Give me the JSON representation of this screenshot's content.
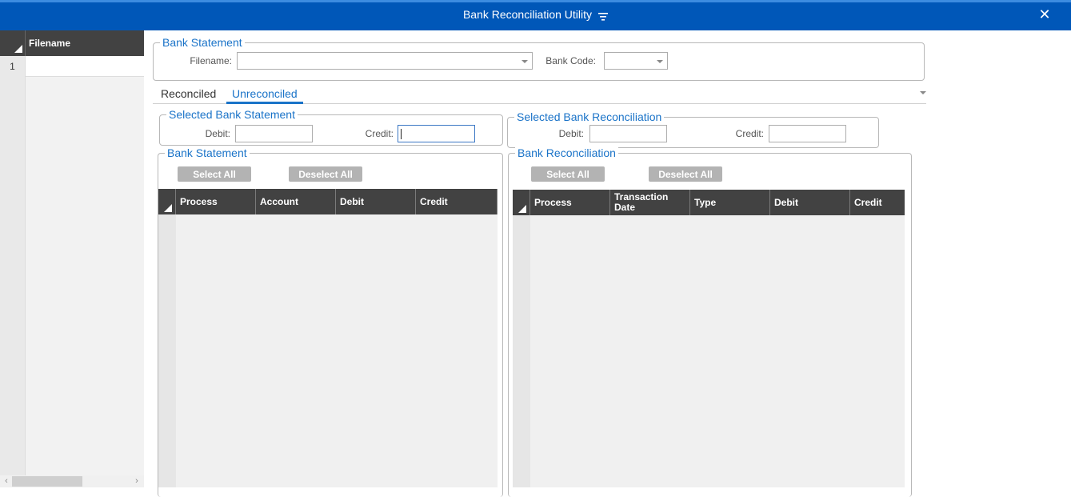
{
  "window": {
    "title": "Bank Reconciliation Utility",
    "title_icon": "filter-lines-icon",
    "close_glyph": "✕",
    "colors": {
      "titlebar": "#0057b8",
      "accent": "#1a73c8",
      "grid_header": "#424242",
      "button": "#b3b3b3"
    }
  },
  "file_list": {
    "column_header": "Filename",
    "rows": [
      {
        "num": "1",
        "filename": ""
      }
    ]
  },
  "bank_statement": {
    "legend": "Bank Statement",
    "filename_label": "Filename:",
    "filename_value": "",
    "bank_code_label": "Bank Code:",
    "bank_code_value": ""
  },
  "tabs": [
    {
      "label": "Reconciled",
      "active": false
    },
    {
      "label": "Unreconciled",
      "active": true
    }
  ],
  "selected_statement": {
    "legend": "Selected Bank Statement",
    "debit_label": "Debit:",
    "debit_value": "",
    "credit_label": "Credit:",
    "credit_value": ""
  },
  "selected_reconciliation": {
    "legend": "Selected Bank Reconciliation",
    "debit_label": "Debit:",
    "debit_value": "",
    "credit_label": "Credit:",
    "credit_value": ""
  },
  "statement_grid": {
    "legend": "Bank Statement",
    "select_all": "Select All",
    "deselect_all": "Deselect All",
    "columns": [
      "Process",
      "Account",
      "Debit",
      "Credit"
    ]
  },
  "reconciliation_grid": {
    "legend": "Bank Reconciliation",
    "select_all": "Select All",
    "deselect_all": "Deselect All",
    "columns": [
      "Process",
      "Transaction Date",
      "Type",
      "Debit",
      "Credit"
    ]
  }
}
